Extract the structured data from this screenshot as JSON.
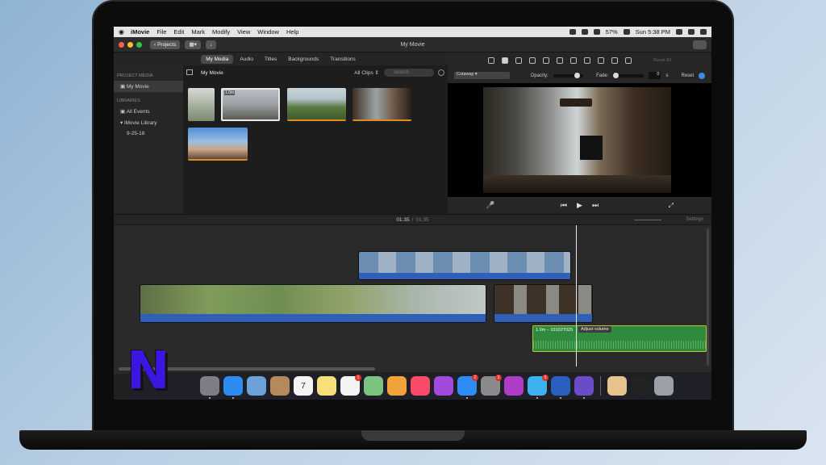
{
  "menubar": {
    "apple": "",
    "items": [
      "iMovie",
      "File",
      "Edit",
      "Mark",
      "Modify",
      "View",
      "Window",
      "Help"
    ],
    "battery": "57%",
    "clock": "Sun 5:38 PM"
  },
  "window": {
    "title": "My Movie",
    "projects_button": "Projects"
  },
  "media_tabs": [
    "My Media",
    "Audio",
    "Titles",
    "Backgrounds",
    "Transitions"
  ],
  "sidebar": {
    "project_media_header": "PROJECT MEDIA",
    "project_item": "My Movie",
    "libraries_header": "LIBRARIES",
    "all_events": "All Events",
    "library": "iMovie Library",
    "event": "9-25-18"
  },
  "browser": {
    "name": "My Movie",
    "filter": "All Clips",
    "search_placeholder": "Search",
    "first_clip_duration": "1.0m"
  },
  "adjust": {
    "style": "Cutaway",
    "opacity_label": "Opacity:",
    "opacity_value": 0.85,
    "fade_label": "Fade:",
    "fade_value": "0",
    "fade_unit": "s",
    "reset": "Reset",
    "reset_all": "Reset All"
  },
  "timeline": {
    "current": "01:35",
    "separator": "/",
    "total": "01:35",
    "settings": "Settings",
    "audio_clip_label": "1.0m – 10102T025",
    "tooltip": "Adjust volume"
  },
  "dock": {
    "apps": [
      {
        "name": "finder-icon",
        "color": "#4aa3e8"
      },
      {
        "name": "launchpad-icon",
        "color": "#7d7d88"
      },
      {
        "name": "safari-icon",
        "color": "#2d8cf0"
      },
      {
        "name": "preview-icon",
        "color": "#6aa1d6"
      },
      {
        "name": "contacts-icon",
        "color": "#b48a5a"
      },
      {
        "name": "calendar-icon",
        "color": "#f4f4f4"
      },
      {
        "name": "notes-icon",
        "color": "#f7e07a"
      },
      {
        "name": "reminders-icon",
        "color": "#f3f3f3",
        "badge": "1"
      },
      {
        "name": "maps-icon",
        "color": "#7bc47f"
      },
      {
        "name": "photos-icon",
        "color": "#f2a23a"
      },
      {
        "name": "music-icon",
        "color": "#fa4a6a"
      },
      {
        "name": "podcasts-icon",
        "color": "#a04bdc"
      },
      {
        "name": "app-store-icon",
        "color": "#2f8cf2",
        "badge": "2"
      },
      {
        "name": "system-preferences-icon",
        "color": "#8a8a8a",
        "badge": "3"
      },
      {
        "name": "feedback-icon",
        "color": "#b03bc4"
      },
      {
        "name": "messages-icon",
        "color": "#3eb1f0",
        "badge": "5"
      },
      {
        "name": "word-icon",
        "color": "#2b5fbf"
      },
      {
        "name": "imovie-icon",
        "color": "#6a4cc7"
      },
      {
        "name": "downloads-icon",
        "color": "#e6c38a"
      },
      {
        "name": "screenshot-icon",
        "color": "#222"
      },
      {
        "name": "trash-icon",
        "color": "#9aa0a6"
      }
    ],
    "calendar_day": "7"
  },
  "overlay": {
    "logo_letter": "N"
  }
}
